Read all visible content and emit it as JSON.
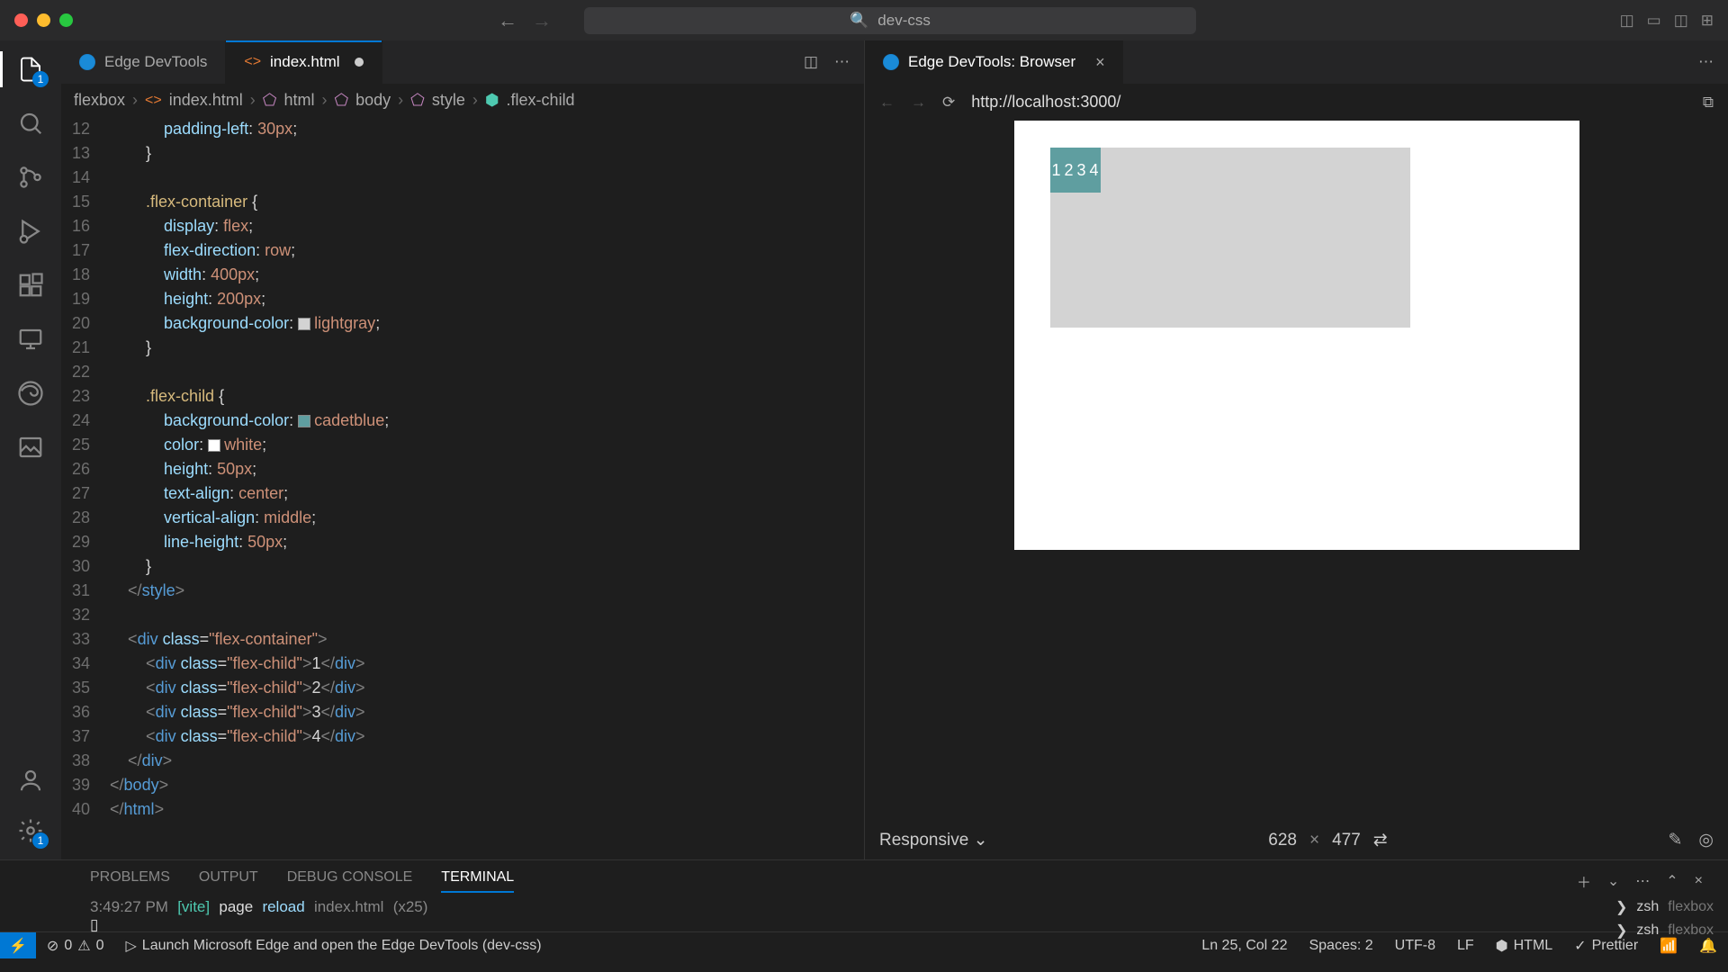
{
  "titlebar": {
    "search": "dev-css"
  },
  "tabs": {
    "devtools": "Edge DevTools",
    "index": "index.html"
  },
  "browserTab": "Edge DevTools: Browser",
  "breadcrumb": [
    "flexbox",
    "index.html",
    "html",
    "body",
    "style",
    ".flex-child"
  ],
  "url": "http://localhost:3000/",
  "devicebar": {
    "mode": "Responsive",
    "w": "628",
    "h": "477"
  },
  "code": {
    "start": 12,
    "lines": [
      {
        "n": 12,
        "html": "            <span class='p-prop'>padding-left</span>: <span class='p-val'>30px</span>;"
      },
      {
        "n": 13,
        "html": "        }"
      },
      {
        "n": 14,
        "html": ""
      },
      {
        "n": 15,
        "html": "        <span class='p-sel'>.flex-container</span> {"
      },
      {
        "n": 16,
        "html": "            <span class='p-prop'>display</span>: <span class='p-val'>flex</span>;"
      },
      {
        "n": 17,
        "html": "            <span class='p-prop'>flex-direction</span>: <span class='p-val'>row</span>;"
      },
      {
        "n": 18,
        "html": "            <span class='p-prop'>width</span>: <span class='p-val'>400px</span>;"
      },
      {
        "n": 19,
        "html": "            <span class='p-prop'>height</span>: <span class='p-val'>200px</span>;"
      },
      {
        "n": 20,
        "html": "            <span class='p-prop'>background-color</span>: <span class='swatch sw-lightgray'></span><span class='p-val'>lightgray</span>;"
      },
      {
        "n": 21,
        "html": "        }"
      },
      {
        "n": 22,
        "html": ""
      },
      {
        "n": 23,
        "html": "        <span class='p-sel'>.flex-child</span> {"
      },
      {
        "n": 24,
        "html": "            <span class='p-prop'>background-color</span>: <span class='swatch sw-cadetblue'></span><span class='p-val'>cadetblue</span>;"
      },
      {
        "n": 25,
        "html": "            <span class='p-prop'>color</span>: <span class='swatch sw-white'></span><span class='p-val'>white</span>;"
      },
      {
        "n": 26,
        "html": "            <span class='p-prop'>height</span>: <span class='p-val'>50px</span>;"
      },
      {
        "n": 27,
        "html": "            <span class='p-prop'>text-align</span>: <span class='p-val'>center</span>;"
      },
      {
        "n": 28,
        "html": "            <span class='p-prop'>vertical-align</span>: <span class='p-val'>middle</span>;"
      },
      {
        "n": 29,
        "html": "            <span class='p-prop'>line-height</span>: <span class='p-val'>50px</span>;"
      },
      {
        "n": 30,
        "html": "        }"
      },
      {
        "n": 31,
        "html": "    <span class='p-punct'>&lt;/</span><span class='p-tag'>style</span><span class='p-punct'>&gt;</span>"
      },
      {
        "n": 32,
        "html": ""
      },
      {
        "n": 33,
        "html": "    <span class='p-punct'>&lt;</span><span class='p-tag'>div</span> <span class='p-attr'>class</span>=<span class='p-str'>\"flex-container\"</span><span class='p-punct'>&gt;</span>"
      },
      {
        "n": 34,
        "html": "        <span class='p-punct'>&lt;</span><span class='p-tag'>div</span> <span class='p-attr'>class</span>=<span class='p-str'>\"flex-child\"</span><span class='p-punct'>&gt;</span>1<span class='p-punct'>&lt;/</span><span class='p-tag'>div</span><span class='p-punct'>&gt;</span>"
      },
      {
        "n": 35,
        "html": "        <span class='p-punct'>&lt;</span><span class='p-tag'>div</span> <span class='p-attr'>class</span>=<span class='p-str'>\"flex-child\"</span><span class='p-punct'>&gt;</span>2<span class='p-punct'>&lt;/</span><span class='p-tag'>div</span><span class='p-punct'>&gt;</span>"
      },
      {
        "n": 36,
        "html": "        <span class='p-punct'>&lt;</span><span class='p-tag'>div</span> <span class='p-attr'>class</span>=<span class='p-str'>\"flex-child\"</span><span class='p-punct'>&gt;</span>3<span class='p-punct'>&lt;/</span><span class='p-tag'>div</span><span class='p-punct'>&gt;</span>"
      },
      {
        "n": 37,
        "html": "        <span class='p-punct'>&lt;</span><span class='p-tag'>div</span> <span class='p-attr'>class</span>=<span class='p-str'>\"flex-child\"</span><span class='p-punct'>&gt;</span>4<span class='p-punct'>&lt;/</span><span class='p-tag'>div</span><span class='p-punct'>&gt;</span>"
      },
      {
        "n": 38,
        "html": "    <span class='p-punct'>&lt;/</span><span class='p-tag'>div</span><span class='p-punct'>&gt;</span>"
      },
      {
        "n": 39,
        "html": "<span class='p-punct'>&lt;/</span><span class='p-tag'>body</span><span class='p-punct'>&gt;</span>"
      },
      {
        "n": 40,
        "html": "<span class='p-punct'>&lt;/</span><span class='p-tag'>html</span><span class='p-punct'>&gt;</span>"
      }
    ]
  },
  "preview": {
    "children": [
      "1",
      "2",
      "3",
      "4"
    ]
  },
  "panel": {
    "tabs": [
      "PROBLEMS",
      "OUTPUT",
      "DEBUG CONSOLE",
      "TERMINAL"
    ],
    "active": 3,
    "terminal": {
      "time": "3:49:27 PM",
      "vite": "[vite]",
      "msg1": "page",
      "msg2": "reload",
      "file": "index.html",
      "count": "(x25)"
    },
    "termlist": [
      {
        "shell": "zsh",
        "dir": "flexbox"
      },
      {
        "shell": "zsh",
        "dir": "flexbox"
      }
    ]
  },
  "status": {
    "errors": "0",
    "warnings": "0",
    "launch": "Launch Microsoft Edge and open the Edge DevTools (dev-css)",
    "lncol": "Ln 25, Col 22",
    "spaces": "Spaces: 2",
    "enc": "UTF-8",
    "eol": "LF",
    "lang": "HTML",
    "prettier": "Prettier"
  }
}
